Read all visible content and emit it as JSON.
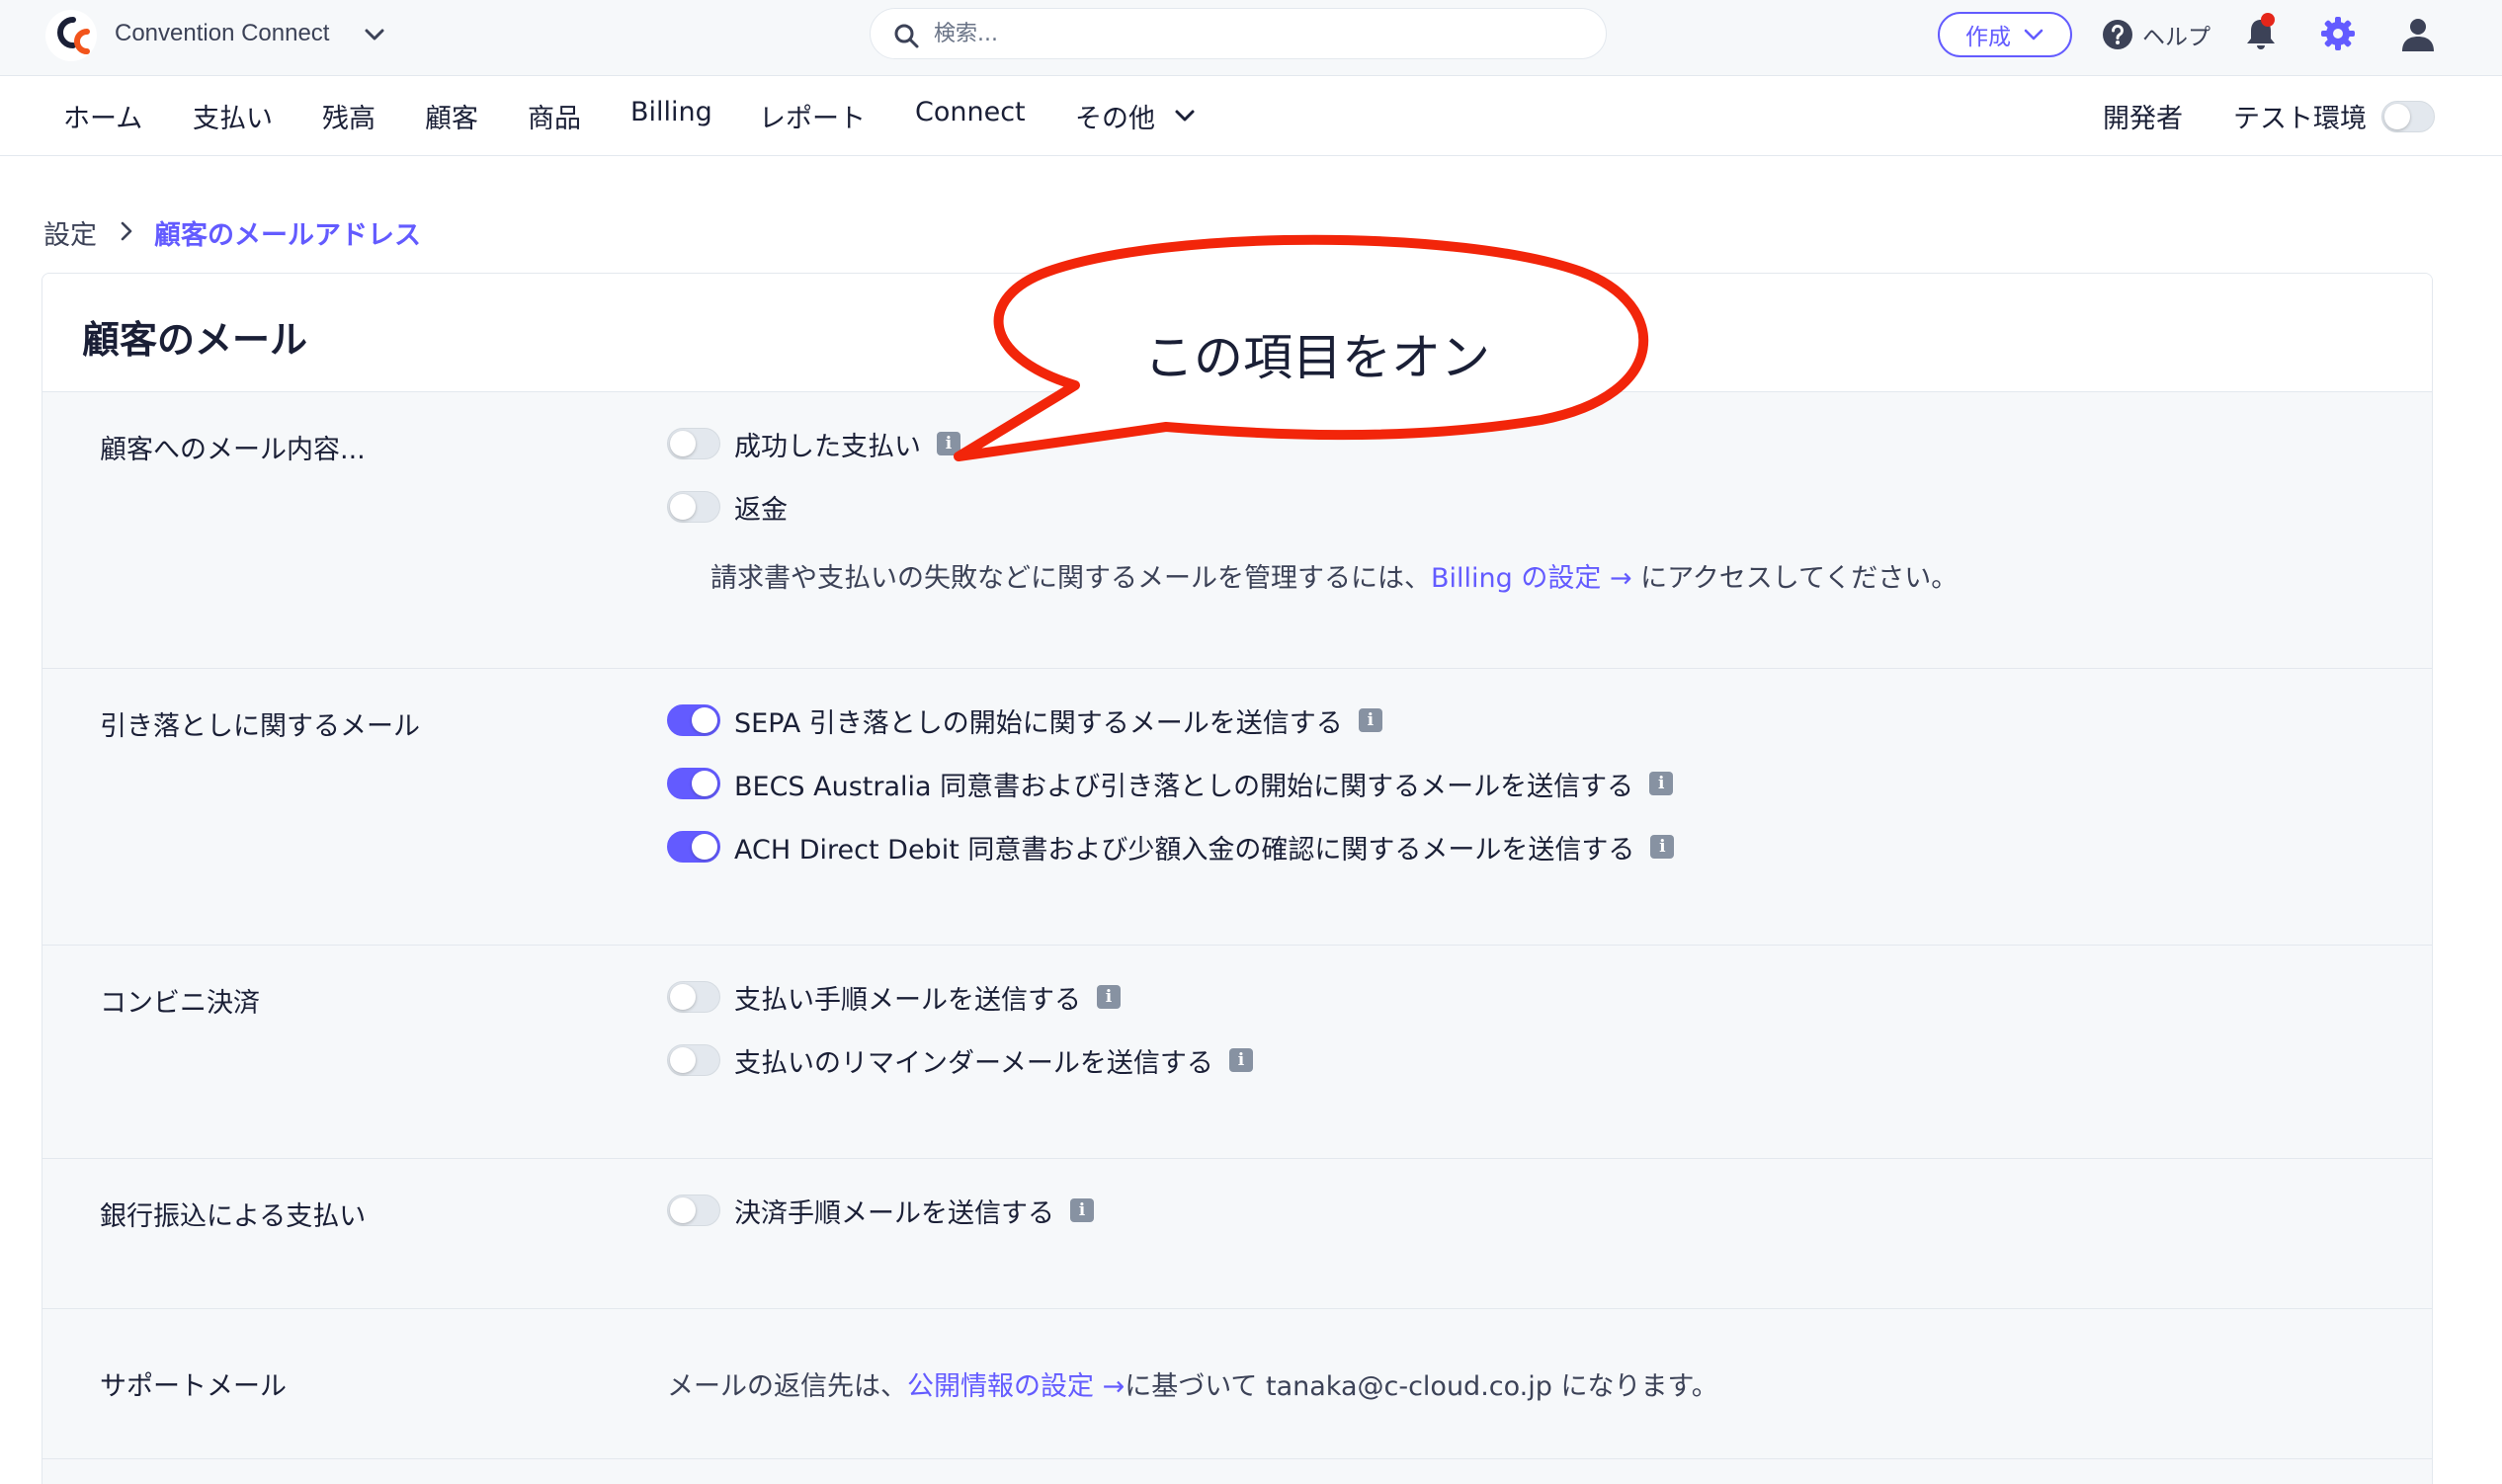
{
  "topbar": {
    "app_name": "Convention Connect",
    "search_placeholder": "検索...",
    "create_label": "作成",
    "help_label": "ヘルプ"
  },
  "nav": {
    "items": [
      "ホーム",
      "支払い",
      "残高",
      "顧客",
      "商品",
      "Billing",
      "レポート",
      "Connect",
      "その他"
    ],
    "developer_label": "開発者",
    "test_env_label": "テスト環境"
  },
  "breadcrumb": {
    "root": "設定",
    "current": "顧客のメールアドレス"
  },
  "panel": {
    "title": "顧客のメール",
    "sections": {
      "customer_content": {
        "label": "顧客へのメール内容...",
        "options": [
          {
            "label": "成功した支払い",
            "on": false,
            "info": true
          },
          {
            "label": "返金",
            "on": false,
            "info": false
          }
        ],
        "note_before": "請求書や支払いの失敗などに関するメールを管理するには、",
        "note_link": "Billing の設定 →",
        "note_after": " にアクセスしてください。"
      },
      "debit": {
        "label": "引き落としに関するメール",
        "options": [
          {
            "label": "SEPA 引き落としの開始に関するメールを送信する",
            "on": true,
            "info": true
          },
          {
            "label": "BECS Australia 同意書および引き落としの開始に関するメールを送信する",
            "on": true,
            "info": true
          },
          {
            "label": "ACH Direct Debit 同意書および少額入金の確認に関するメールを送信する",
            "on": true,
            "info": true
          }
        ]
      },
      "konbini": {
        "label": "コンビニ決済",
        "options": [
          {
            "label": "支払い手順メールを送信する",
            "on": false,
            "info": true
          },
          {
            "label": "支払いのリマインダーメールを送信する",
            "on": false,
            "info": true
          }
        ]
      },
      "bank_transfer": {
        "label": "銀行振込による支払い",
        "options": [
          {
            "label": "決済手順メールを送信する",
            "on": false,
            "info": true
          }
        ]
      },
      "support": {
        "label": "サポートメール",
        "text_before": "メールの返信先は、",
        "link": "公開情報の設定 →",
        "text_after": "に基づいて tanaka@c-cloud.co.jp になります。"
      }
    }
  },
  "annotation": {
    "callout_text": "この項目をオン",
    "color": "#f2250a"
  },
  "colors": {
    "accent": "#635bff",
    "notification": "#e5261a",
    "logo_orange": "#f2541b"
  },
  "icons": [
    "search-icon",
    "chevron-down-icon",
    "help-icon",
    "bell-icon",
    "gear-icon",
    "user-icon",
    "chevron-right-icon",
    "info-icon"
  ]
}
